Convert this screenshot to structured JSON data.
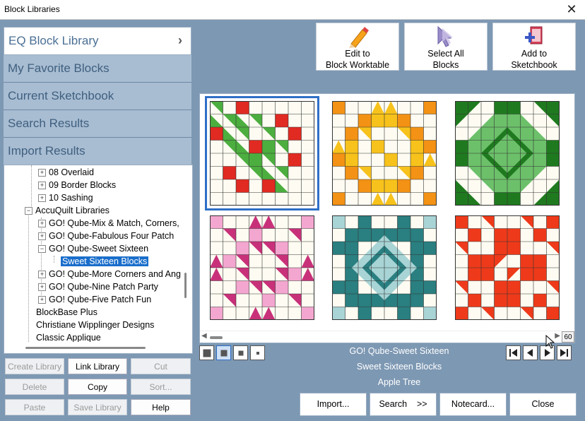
{
  "window": {
    "title": "Block Libraries",
    "close_glyph": "✕"
  },
  "library_tabs": [
    {
      "label": "EQ Block Library",
      "active": true,
      "chevron": "›"
    },
    {
      "label": "My Favorite Blocks",
      "active": false
    },
    {
      "label": "Current Sketchbook",
      "active": false
    },
    {
      "label": "Search Results",
      "active": false
    },
    {
      "label": "Import Results",
      "active": false
    }
  ],
  "tree": [
    {
      "label": "08 Overlaid",
      "expander": "+",
      "level": 2
    },
    {
      "label": "09 Border Blocks",
      "expander": "+",
      "level": 2
    },
    {
      "label": "10 Sashing",
      "expander": "+",
      "level": 2
    },
    {
      "label": "AccuQuilt Libraries",
      "expander": "−",
      "level": 1
    },
    {
      "label": "GO! Qube-Mix & Match, Corners,",
      "expander": "+",
      "level": 2
    },
    {
      "label": "GO! Qube-Fabulous Four Patch",
      "expander": "+",
      "level": 2
    },
    {
      "label": "GO! Qube-Sweet Sixteen",
      "expander": "−",
      "level": 2
    },
    {
      "label": "Sweet Sixteen Blocks",
      "expander": "",
      "level": 3,
      "selected": true
    },
    {
      "label": "GO! Qube-More Corners and Ang",
      "expander": "+",
      "level": 2
    },
    {
      "label": "GO! Qube-Nine Patch Party",
      "expander": "+",
      "level": 2
    },
    {
      "label": "GO! Qube-Five Patch Fun",
      "expander": "+",
      "level": 2
    },
    {
      "label": "BlockBase Plus",
      "expander": "",
      "level": 1
    },
    {
      "label": "Christiane Wipplinger Designs",
      "expander": "",
      "level": 1
    },
    {
      "label": "Classic Applique",
      "expander": "",
      "level": 1
    }
  ],
  "library_buttons": {
    "create_library": "Create Library",
    "link_library": "Link Library",
    "cut": "Cut",
    "delete": "Delete",
    "copy": "Copy",
    "sort": "Sort...",
    "paste": "Paste",
    "save_library": "Save Library",
    "help": "Help"
  },
  "toolbar": {
    "edit_line1": "Edit to",
    "edit_line2": "Block Worktable",
    "select_line1": "Select All",
    "select_line2": "Blocks",
    "add_line1": "Add to",
    "add_line2": "Sketchbook"
  },
  "blocks": [
    {
      "name": "block-1",
      "color": "#4cae3f",
      "accent": "#e02a22",
      "selected": true
    },
    {
      "name": "block-2",
      "color": "#f7c21b",
      "accent": "#f39214"
    },
    {
      "name": "block-3",
      "color": "#1f7a1f",
      "accent": "#6cc06a"
    },
    {
      "name": "block-4",
      "color": "#c8317a",
      "accent": "#f3a6cf"
    },
    {
      "name": "block-5",
      "color": "#2a7f80",
      "accent": "#a8d4d6"
    },
    {
      "name": "block-6",
      "color": "#ee3a1a",
      "accent": "#ee3a1a"
    }
  ],
  "zoom_value": "60",
  "selection_info": {
    "library": "GO! Qube-Sweet Sixteen",
    "style": "Sweet Sixteen Blocks",
    "block_name": "Apple Tree"
  },
  "bottom_buttons": {
    "import": "Import...",
    "search": "Search",
    "search_arrow": ">>",
    "notecard": "Notecard...",
    "close": "Close"
  },
  "colors": {
    "background": "#7d98b3",
    "tab_inactive": "#a8bdd2",
    "selection": "#1a6ecb"
  }
}
